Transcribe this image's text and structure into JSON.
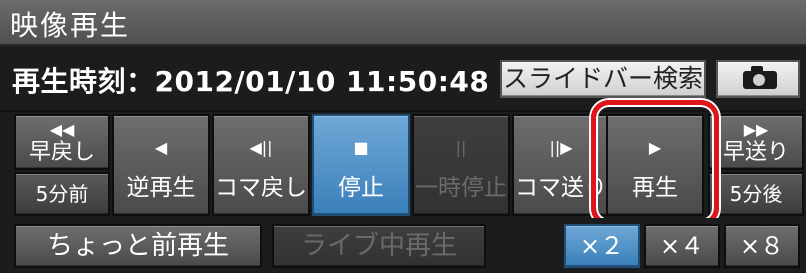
{
  "window": {
    "title": "映像再生"
  },
  "timebar": {
    "label": "再生時刻：2012/01/10 11:50:48",
    "slide_search_label": "スライドバー検索"
  },
  "controls": {
    "rewind": {
      "icon": "◀◀",
      "label": "早戻し",
      "sub_label": "5分前"
    },
    "reverse_play": {
      "icon": "◀",
      "label": "逆再生"
    },
    "frame_back": {
      "icon": "◀||",
      "label": "コマ戻し"
    },
    "stop": {
      "icon": "■",
      "label": "停止",
      "state": "active"
    },
    "pause": {
      "icon": "||",
      "label": "一時停止",
      "state": "disabled"
    },
    "frame_forward": {
      "icon": "||▶",
      "label": "コマ送り"
    },
    "play": {
      "icon": "▶",
      "label": "再生",
      "highlighted": true
    },
    "fast_forward": {
      "icon": "▶▶",
      "label": "早送り",
      "sub_label": "5分後"
    }
  },
  "bottom": {
    "recent_play_label": "ちょっと前再生",
    "live_play_label": "ライブ中再生",
    "speeds": [
      "×２",
      "×４",
      "×８"
    ],
    "selected_speed": "×２"
  },
  "colors": {
    "active_blue": "#4a8dc6",
    "highlight_red": "#e0151b",
    "panel_dark": "#1b1c1e"
  }
}
